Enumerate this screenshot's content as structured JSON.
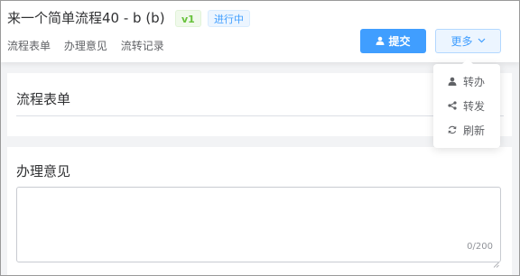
{
  "header": {
    "title": "来一个简单流程40 - b (b)",
    "version_tag": "v1",
    "status_tag": "进行中",
    "tabs": [
      {
        "label": "流程表单"
      },
      {
        "label": "办理意见"
      },
      {
        "label": "流转记录"
      }
    ],
    "submit_label": "提交",
    "more_label": "更多"
  },
  "dropdown": {
    "items": [
      {
        "label": "转办",
        "icon": "user-icon"
      },
      {
        "label": "转发",
        "icon": "share-icon"
      },
      {
        "label": "刷新",
        "icon": "refresh-icon"
      }
    ]
  },
  "form_section": {
    "title": "流程表单"
  },
  "opinion_section": {
    "title": "办理意见",
    "textarea_value": "",
    "counter": "0/200"
  },
  "colors": {
    "primary": "#409eff",
    "version_tag": "#67c23a",
    "background": "#f2f3f5"
  }
}
